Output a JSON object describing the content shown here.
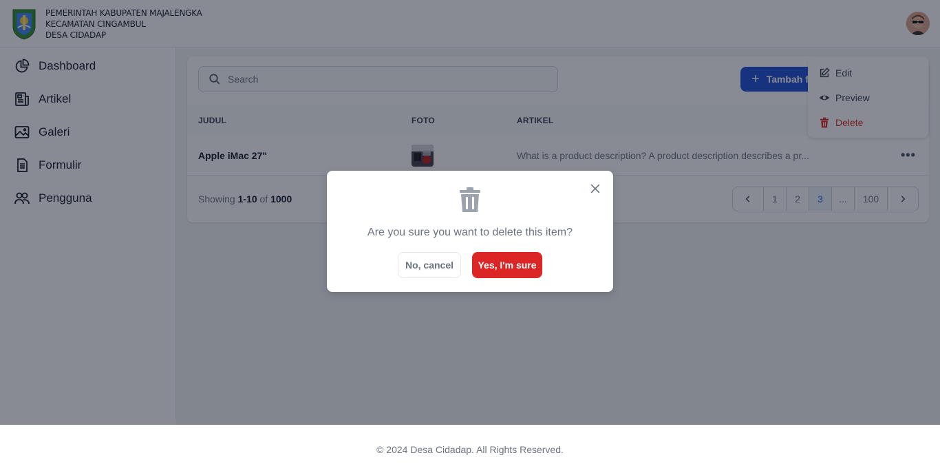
{
  "header": {
    "line1": "PEMERINTAH KABUPATEN MAJALENGKA",
    "line2": "KECAMATAN CINGAMBUL",
    "line3": "DESA CIDADAP"
  },
  "sidebar": {
    "items": [
      {
        "label": "Dashboard",
        "icon": "pie-chart-icon"
      },
      {
        "label": "Artikel",
        "icon": "newspaper-icon"
      },
      {
        "label": "Galeri",
        "icon": "image-icon"
      },
      {
        "label": "Formulir",
        "icon": "document-icon"
      },
      {
        "label": "Pengguna",
        "icon": "users-icon"
      }
    ]
  },
  "toolbar": {
    "search_placeholder": "Search",
    "add_button_label": "Tambah f"
  },
  "table": {
    "headers": [
      "JUDUL",
      "FOTO",
      "ARTIKEL"
    ],
    "rows": [
      {
        "title": "Apple iMac 27\"",
        "description": "What is a product description? A product description describes a pr..."
      }
    ]
  },
  "pagination": {
    "showing_prefix": "Showing",
    "range": "1-10",
    "of_label": "of",
    "total": "1000",
    "pages": [
      "1",
      "2",
      "3",
      "...",
      "100"
    ],
    "active_page": "3"
  },
  "dropdown": {
    "items": [
      {
        "label": "Edit",
        "icon": "pencil-square-icon"
      },
      {
        "label": "Preview",
        "icon": "eye-icon"
      },
      {
        "label": "Delete",
        "icon": "trash-icon"
      }
    ]
  },
  "modal": {
    "message": "Are you sure you want to delete this item?",
    "cancel_label": "No, cancel",
    "confirm_label": "Yes, I'm sure"
  },
  "footer": {
    "text": "© 2024 Desa Cidadap. All Rights Reserved."
  },
  "colors": {
    "primary": "#1d4ed8",
    "danger": "#dc2626",
    "overlay": "#111827"
  }
}
